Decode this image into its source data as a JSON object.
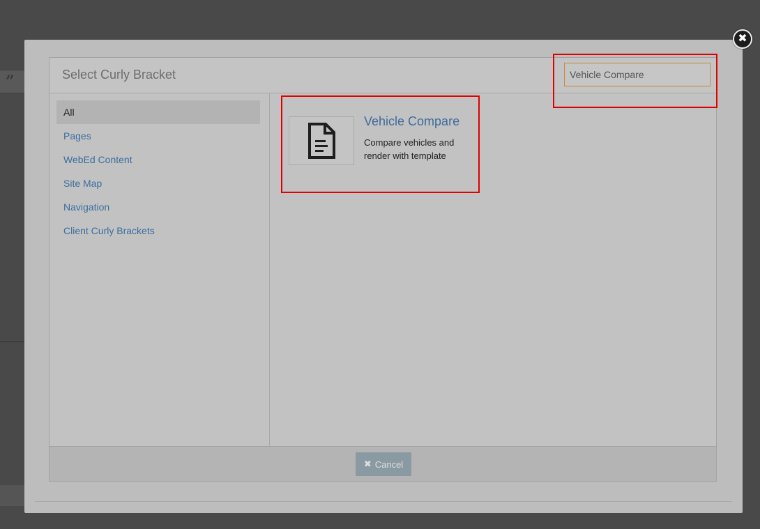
{
  "dialog": {
    "title": "Select Curly Bracket",
    "close_glyph": "✖"
  },
  "search": {
    "value": "Vehicle Compare",
    "placeholder": ""
  },
  "sidebar": {
    "items": [
      {
        "label": "All",
        "active": true
      },
      {
        "label": "Pages"
      },
      {
        "label": "WebEd Content"
      },
      {
        "label": "Site Map"
      },
      {
        "label": "Navigation"
      },
      {
        "label": "Client Curly Brackets"
      }
    ]
  },
  "results": [
    {
      "title": "Vehicle Compare",
      "description": "Compare vehicles and render with template",
      "icon": "document-icon"
    }
  ],
  "footer": {
    "cancel_label": "Cancel",
    "cancel_icon": "✖"
  },
  "colors": {
    "link": "#3e6c9d",
    "highlight": "#e00000",
    "search_border": "#c58a3c",
    "cancel_bg": "#8a9aa3"
  }
}
